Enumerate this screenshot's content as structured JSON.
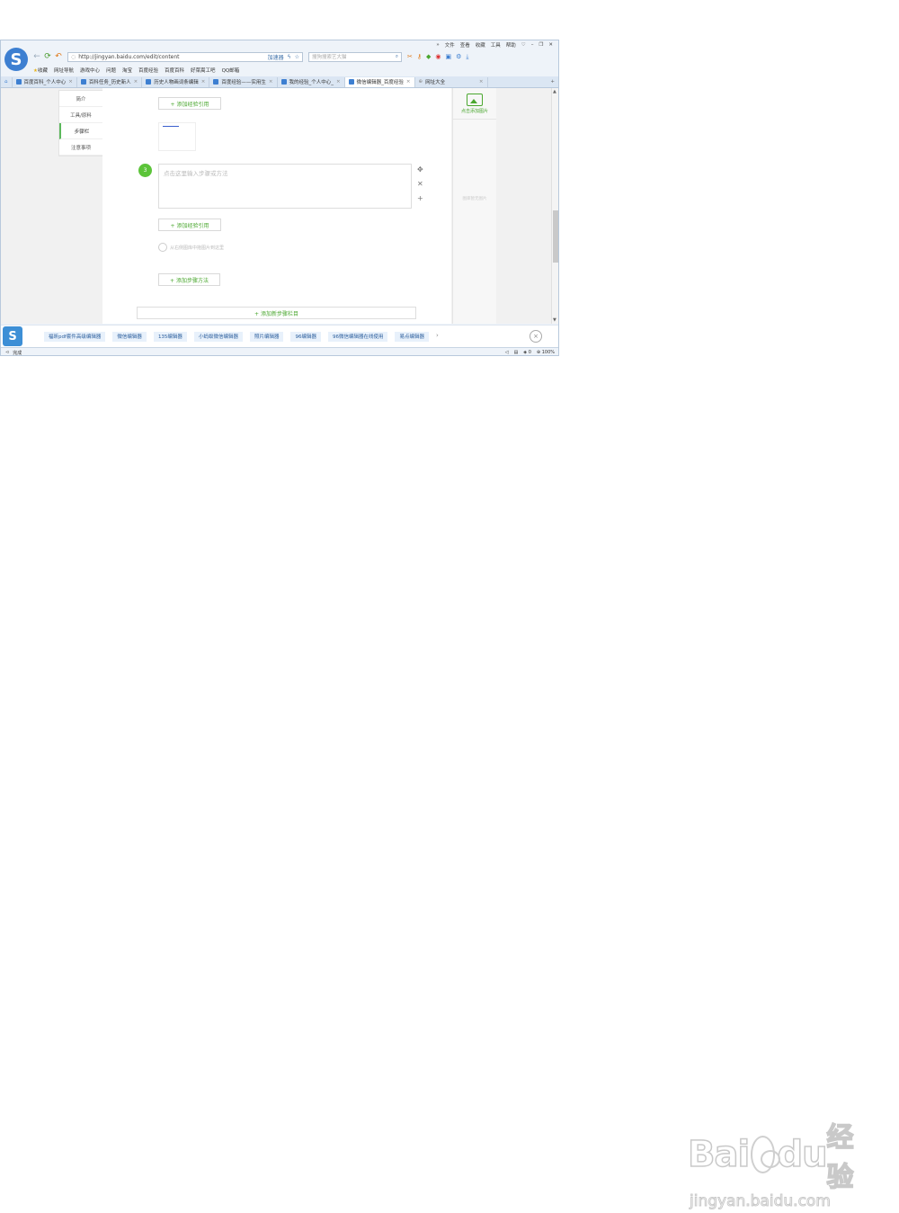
{
  "menu": [
    "»",
    "文件",
    "查看",
    "收藏",
    "工具",
    "帮助"
  ],
  "address": {
    "url": "http://jingyan.baidu.com/edit/content",
    "accelerator": "加速器"
  },
  "search": {
    "placeholder": "搜狗搜索艺大猫"
  },
  "favorites": [
    "收藏",
    "网址导航",
    "游戏中心",
    "问题",
    "淘宝",
    "百度经验",
    "百度百科",
    "好菜嵩工吧",
    "QQ邮箱"
  ],
  "tabs": [
    {
      "label": "百度百科_个人中心"
    },
    {
      "label": "百科任务_历史新人"
    },
    {
      "label": "历史人物画词条编辑"
    },
    {
      "label": "百度经验——实用生"
    },
    {
      "label": "我的经验_个人中心_"
    },
    {
      "label": "微信编辑器_百度经验",
      "active": true
    },
    {
      "label": "网址大全"
    }
  ],
  "sidenav": [
    "简介",
    "工具/原料",
    "步骤栏",
    "注意事项"
  ],
  "editor": {
    "add_citation": "+ 添加经验引用",
    "step_number": "3",
    "step_placeholder": "点击这里输入步骤或方法",
    "add_citation2": "+ 添加经验引用",
    "image_hint": "从右侧图库中拖图片到这里",
    "add_step": "+ 添加步骤方法",
    "add_section": "+ 添加新步骤栏目"
  },
  "right_panel": {
    "add_image": "点击添加图片",
    "no_image": "图库暂无图片"
  },
  "keywords": [
    "福昕pdf套件高级编辑器",
    "微信编辑器",
    "135编辑器",
    "小蚂蚁微信编辑器",
    "照片编辑器",
    "96编辑器",
    "96微信编辑器在线使用",
    "易点编辑器"
  ],
  "status": {
    "text": "完成",
    "count": "0",
    "zoom": "100%"
  },
  "watermark": {
    "brand": "Bai",
    "brand2": "du",
    "cn": "经验",
    "url": "jingyan.baidu.com"
  },
  "colors": {
    "accent": "#4aa72f",
    "step": "#5cc43a",
    "chrome": "#eef3f9"
  }
}
